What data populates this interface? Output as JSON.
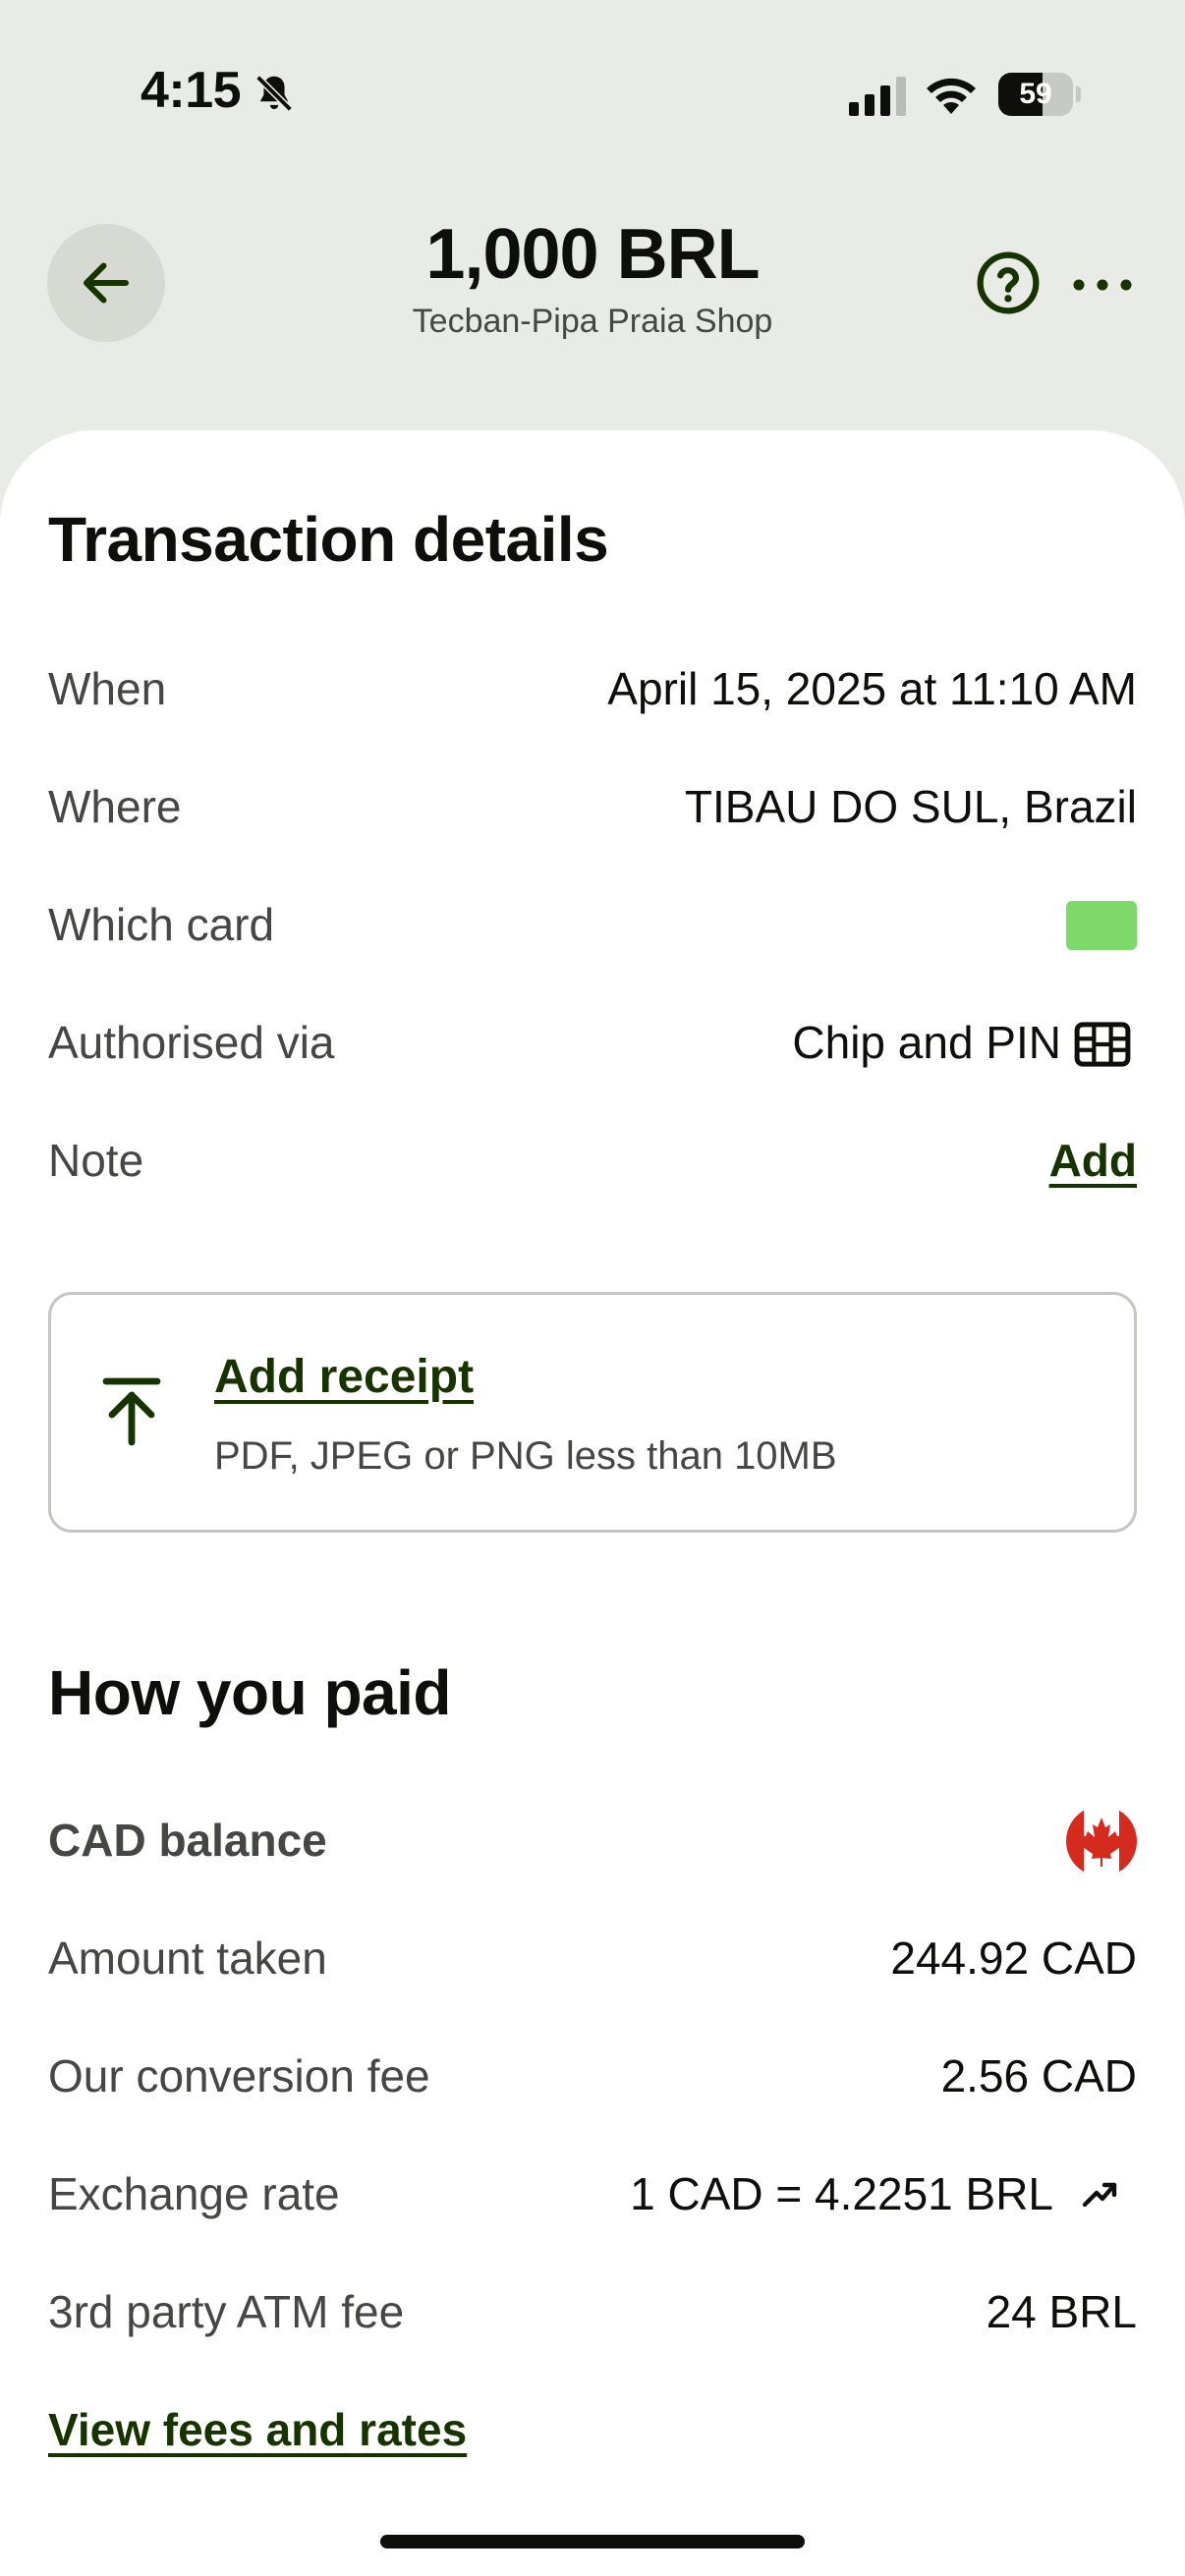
{
  "status_bar": {
    "time": "4:15",
    "battery": "59",
    "battery_level": 0.59
  },
  "header": {
    "amount": "1,000 BRL",
    "merchant": "Tecban-Pipa Praia Shop"
  },
  "transaction_details": {
    "title": "Transaction details",
    "rows": [
      {
        "label": "When",
        "value": "April 15, 2025 at 11:10 AM"
      },
      {
        "label": "Where",
        "value": "TIBAU DO SUL, Brazil"
      },
      {
        "label": "Which card",
        "value": ""
      },
      {
        "label": "Authorised via",
        "value": "Chip and PIN"
      },
      {
        "label": "Note",
        "value": "Add"
      }
    ],
    "card_color": "#7fd86a"
  },
  "receipt": {
    "title": "Add receipt",
    "subtitle": "PDF, JPEG or PNG less than 10MB"
  },
  "how_you_paid": {
    "title": "How you paid",
    "balance_label": "CAD balance",
    "balance_flag": "canada-flag",
    "rows": [
      {
        "label": "Amount taken",
        "value": "244.92 CAD"
      },
      {
        "label": "Our conversion fee",
        "value": "2.56 CAD"
      },
      {
        "label": "Exchange rate",
        "value": "1 CAD = 4.2251 BRL"
      },
      {
        "label": "3rd party ATM fee",
        "value": "24 BRL"
      }
    ],
    "fees_link": "View fees and rates"
  },
  "colors": {
    "accent": "#163300",
    "background": "#e8ebe6",
    "card_green": "#7fd86a",
    "flag_red": "#d52b1e"
  }
}
